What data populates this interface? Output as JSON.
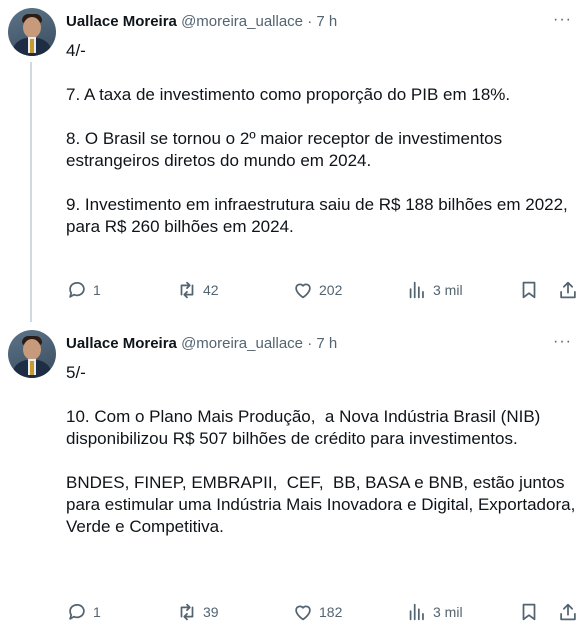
{
  "tweets": [
    {
      "author_name": "Uallace Moreira",
      "author_handle": "@moreira_uallace",
      "separator": "·",
      "time": "7 h",
      "more_label": "···",
      "text": "4/-\n\n7. A taxa de investimento como proporção do PIB em 18%.\n\n8. O Brasil se tornou o 2º maior receptor de investimentos estrangeiros diretos do mundo em 2024.\n\n9. Investimento em infraestrutura saiu de R$ 188 bilhões em 2022, para R$ 260 bilhões em 2024.",
      "replies": "1",
      "retweets": "42",
      "likes": "202",
      "views": "3 mil"
    },
    {
      "author_name": "Uallace Moreira",
      "author_handle": "@moreira_uallace",
      "separator": "·",
      "time": "7 h",
      "more_label": "···",
      "text": "5/-\n\n10. Com o Plano Mais Produção,  a Nova Indústria Brasil (NIB) disponibilizou R$ 507 bilhões de crédito para investimentos.\n\nBNDES, FINEP, EMBRAPII,  CEF,  BB, BASA e BNB, estão juntos para estimular uma Indústria Mais Inovadora e Digital, Exportadora,  Verde e Competitiva.",
      "replies": "1",
      "retweets": "39",
      "likes": "182",
      "views": "3 mil"
    }
  ],
  "icons": {
    "reply": "reply-icon",
    "retweet": "retweet-icon",
    "like": "heart-icon",
    "views": "views-chart-icon",
    "bookmark": "bookmark-icon",
    "share": "share-icon"
  },
  "colors": {
    "text": "#0f1419",
    "secondary": "#536471",
    "thread_line": "#cfd9de"
  }
}
